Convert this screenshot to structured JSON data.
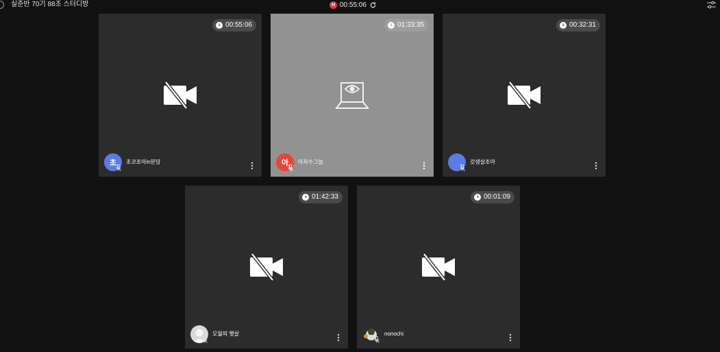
{
  "header": {
    "room_title": "실준반 70기 88조 스터디방",
    "session_timer": "00:55:06",
    "rec_badge": "H"
  },
  "colors": {
    "background": "#111111",
    "tile": "#2c2c2c",
    "camera_tile": "#929292",
    "rec_red": "#e63b35",
    "avatar_blue": "#5b7de3",
    "avatar_red": "#e9443b"
  },
  "participants": [
    {
      "name": "초코조아in분당",
      "timer": "00:55:06",
      "avatar_initial": "초",
      "avatar_color": "#5b7de3",
      "video": "camera-off-icon"
    },
    {
      "name": "아자수그늘",
      "timer": "01:33:35",
      "avatar_initial": "아",
      "avatar_color": "#e9443b",
      "video": "laptop-webcam-icon"
    },
    {
      "name": "갓생살조아",
      "timer": "00:32:31",
      "avatar_initial": "",
      "avatar_color": "#5b7de3",
      "video": "camera-off-icon"
    },
    {
      "name": "오월의 햇살",
      "timer": "01:42:33",
      "avatar_initial": "",
      "avatar_color": "#d9d9d9",
      "video": "camera-off-icon"
    },
    {
      "name": "nonochi",
      "timer": "00:01:09",
      "avatar_initial": "",
      "avatar_color": "#2c2c2c",
      "video": "camera-off-icon"
    }
  ]
}
